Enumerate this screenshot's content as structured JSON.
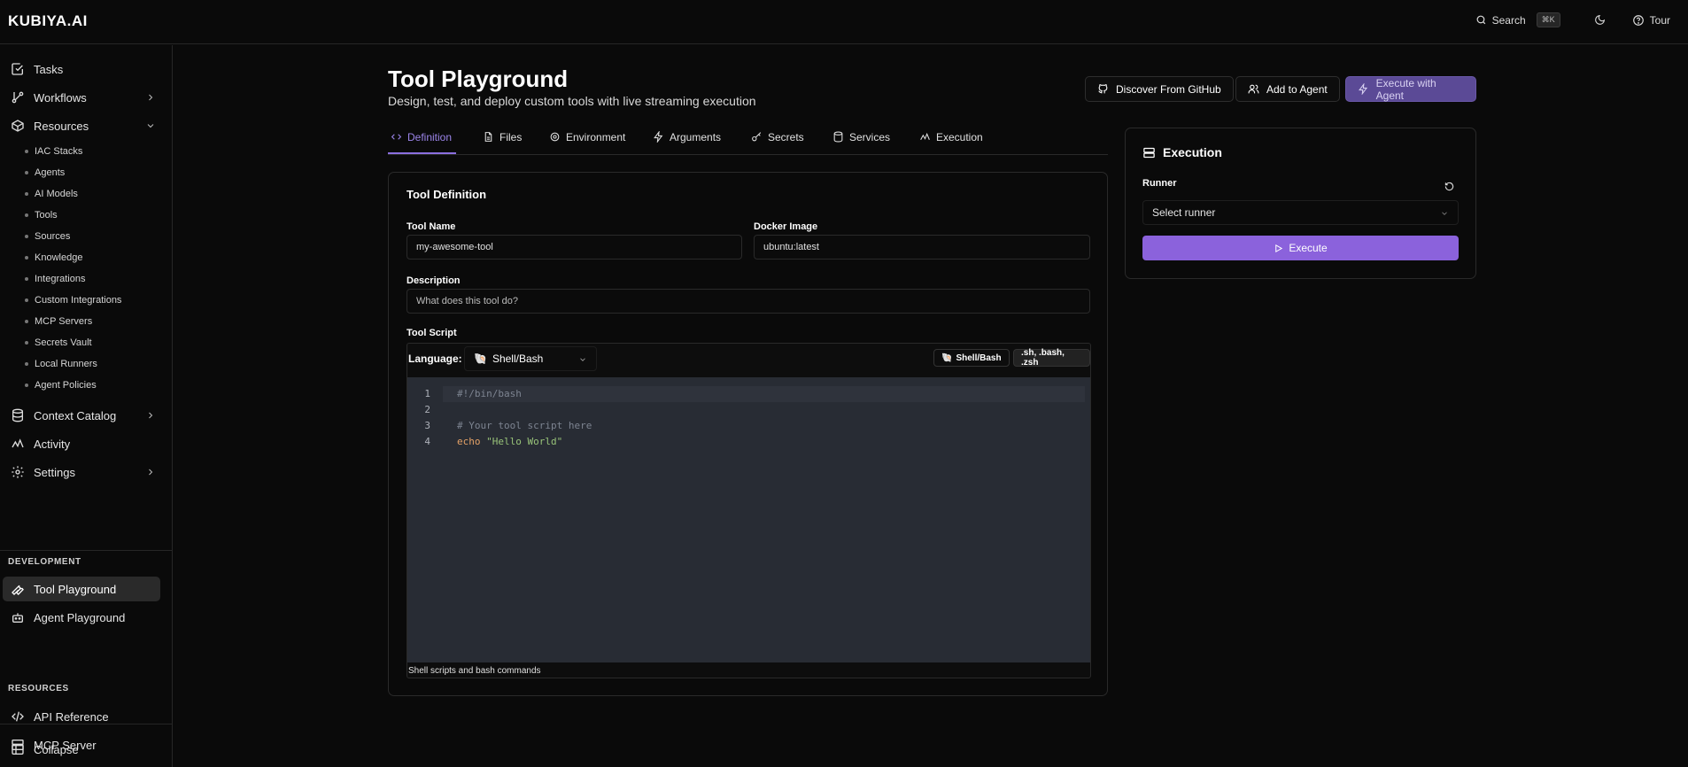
{
  "app": {
    "logo": "KUBIYA.AI"
  },
  "topbar": {
    "search_label": "Search",
    "search_shortcut": "⌘K",
    "tour_label": "Tour"
  },
  "sidebar": {
    "items": [
      {
        "label": "Tasks",
        "icon": "check-square-icon"
      },
      {
        "label": "Workflows",
        "icon": "workflow-icon"
      },
      {
        "label": "Resources",
        "icon": "box-icon"
      },
      {
        "label": "Context Catalog",
        "icon": "database-icon"
      },
      {
        "label": "Activity",
        "icon": "activity-icon"
      },
      {
        "label": "Settings",
        "icon": "gear-icon"
      }
    ],
    "resources_children": [
      "IAC Stacks",
      "Agents",
      "AI Models",
      "Tools",
      "Sources",
      "Knowledge",
      "Integrations",
      "Custom Integrations",
      "MCP Servers",
      "Secrets Vault",
      "Local Runners",
      "Agent Policies"
    ],
    "development_title": "DEVELOPMENT",
    "development_items": [
      {
        "label": "Tool Playground",
        "icon": "wrench-icon"
      },
      {
        "label": "Agent Playground",
        "icon": "bot-icon"
      }
    ],
    "resources_title": "RESOURCES",
    "resources_items": [
      {
        "label": "API Reference",
        "icon": "code-icon"
      },
      {
        "label": "MCP Server",
        "icon": "server-icon"
      }
    ],
    "collapse_label": "Collapse"
  },
  "page": {
    "title": "Tool Playground",
    "subtitle": "Design, test, and deploy custom tools with live streaming execution",
    "actions": {
      "discover": "Discover From GitHub",
      "add_agent": "Add to Agent",
      "execute_agent": "Execute with Agent"
    },
    "tabs": [
      "Definition",
      "Files",
      "Environment",
      "Arguments",
      "Secrets",
      "Services",
      "Execution"
    ],
    "active_tab": "Definition"
  },
  "definition": {
    "card_title": "Tool Definition",
    "tool_name_label": "Tool Name",
    "tool_name_value": "my-awesome-tool",
    "docker_label": "Docker Image",
    "docker_value": "ubuntu:latest",
    "description_label": "Description",
    "description_placeholder": "What does this tool do?",
    "script_label": "Tool Script",
    "language_label": "Language:",
    "language_value": "Shell/Bash",
    "badge_lang": "Shell/Bash",
    "badge_ext": ".sh, .bash, .zsh",
    "code_lines": [
      {
        "n": "1",
        "text": "#!/bin/bash"
      },
      {
        "n": "2",
        "text": ""
      },
      {
        "n": "3",
        "text": "# Your tool script here"
      },
      {
        "n": "4",
        "keyword": "echo",
        "string": "\"Hello World\""
      }
    ],
    "editor_footer": "Shell scripts and bash commands"
  },
  "execution": {
    "title": "Execution",
    "runner_label": "Runner",
    "runner_placeholder": "Select runner",
    "execute_label": "Execute"
  },
  "colors": {
    "accent": "#8b6fe0",
    "execute_button": "#8b62dc",
    "code_bg": "#282c34",
    "string": "#98c379",
    "keyword": "#e5a267"
  }
}
